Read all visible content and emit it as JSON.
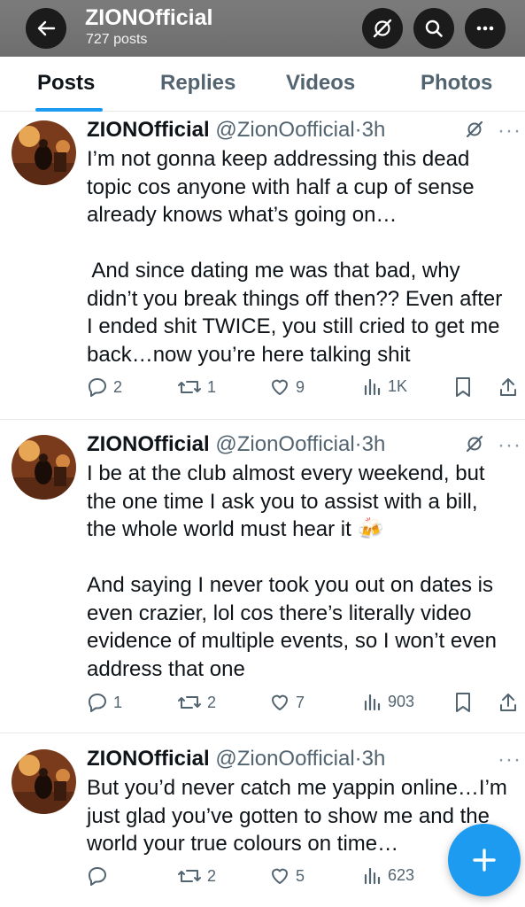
{
  "header": {
    "title": "ZIONOfficial",
    "post_count": "727 posts"
  },
  "tabs": [
    {
      "label": "Posts",
      "active": true
    },
    {
      "label": "Replies",
      "active": false
    },
    {
      "label": "Videos",
      "active": false
    },
    {
      "label": "Photos",
      "active": false
    }
  ],
  "posts": [
    {
      "name": "ZIONOfficial",
      "handle": "@ZionOofficial",
      "separator": "·",
      "time": "3h",
      "lines": [
        "I’m not gonna keep addressing this dead",
        "topic cos anyone with half a cup of sense",
        "already knows what’s going on…",
        "",
        " And since dating me was that bad, why",
        "didn’t you break things off then?? Even after",
        "I ended shit TWICE, you still cried to get me",
        "back…now you’re here talking shit"
      ],
      "replies": "2",
      "reposts": "1",
      "likes": "9",
      "views": "1K"
    },
    {
      "name": "ZIONOfficial",
      "handle": "@ZionOofficial",
      "separator": "·",
      "time": "3h",
      "lines": [
        "I be at the club almost every weekend, but",
        "the one time I ask you to assist with a bill,",
        "the whole world must hear it 🍻",
        "",
        "And saying I never took you out on dates is",
        "even crazier, lol cos there’s literally video",
        "evidence of multiple events, so I won’t even",
        "address that one"
      ],
      "replies": "1",
      "reposts": "2",
      "likes": "7",
      "views": "903"
    },
    {
      "name": "ZIONOfficial",
      "handle": "@ZionOofficial",
      "separator": "·",
      "time": "3h",
      "lines": [
        "But you’d never catch me yappin online…I’m",
        "just glad you’ve gotten to show me and the",
        "world your true colours on time…"
      ],
      "replies": "",
      "reposts": "2",
      "likes": "5",
      "views": "623"
    }
  ],
  "colors": {
    "accent": "#1d9bf0",
    "header_bg": "#737373",
    "secondary_text": "#536471"
  },
  "icons": [
    "back-arrow-icon",
    "grok-icon",
    "search-icon",
    "more-icon",
    "reply-icon",
    "repost-icon",
    "like-icon",
    "views-icon",
    "bookmark-icon",
    "share-icon",
    "compose-plus-icon"
  ]
}
